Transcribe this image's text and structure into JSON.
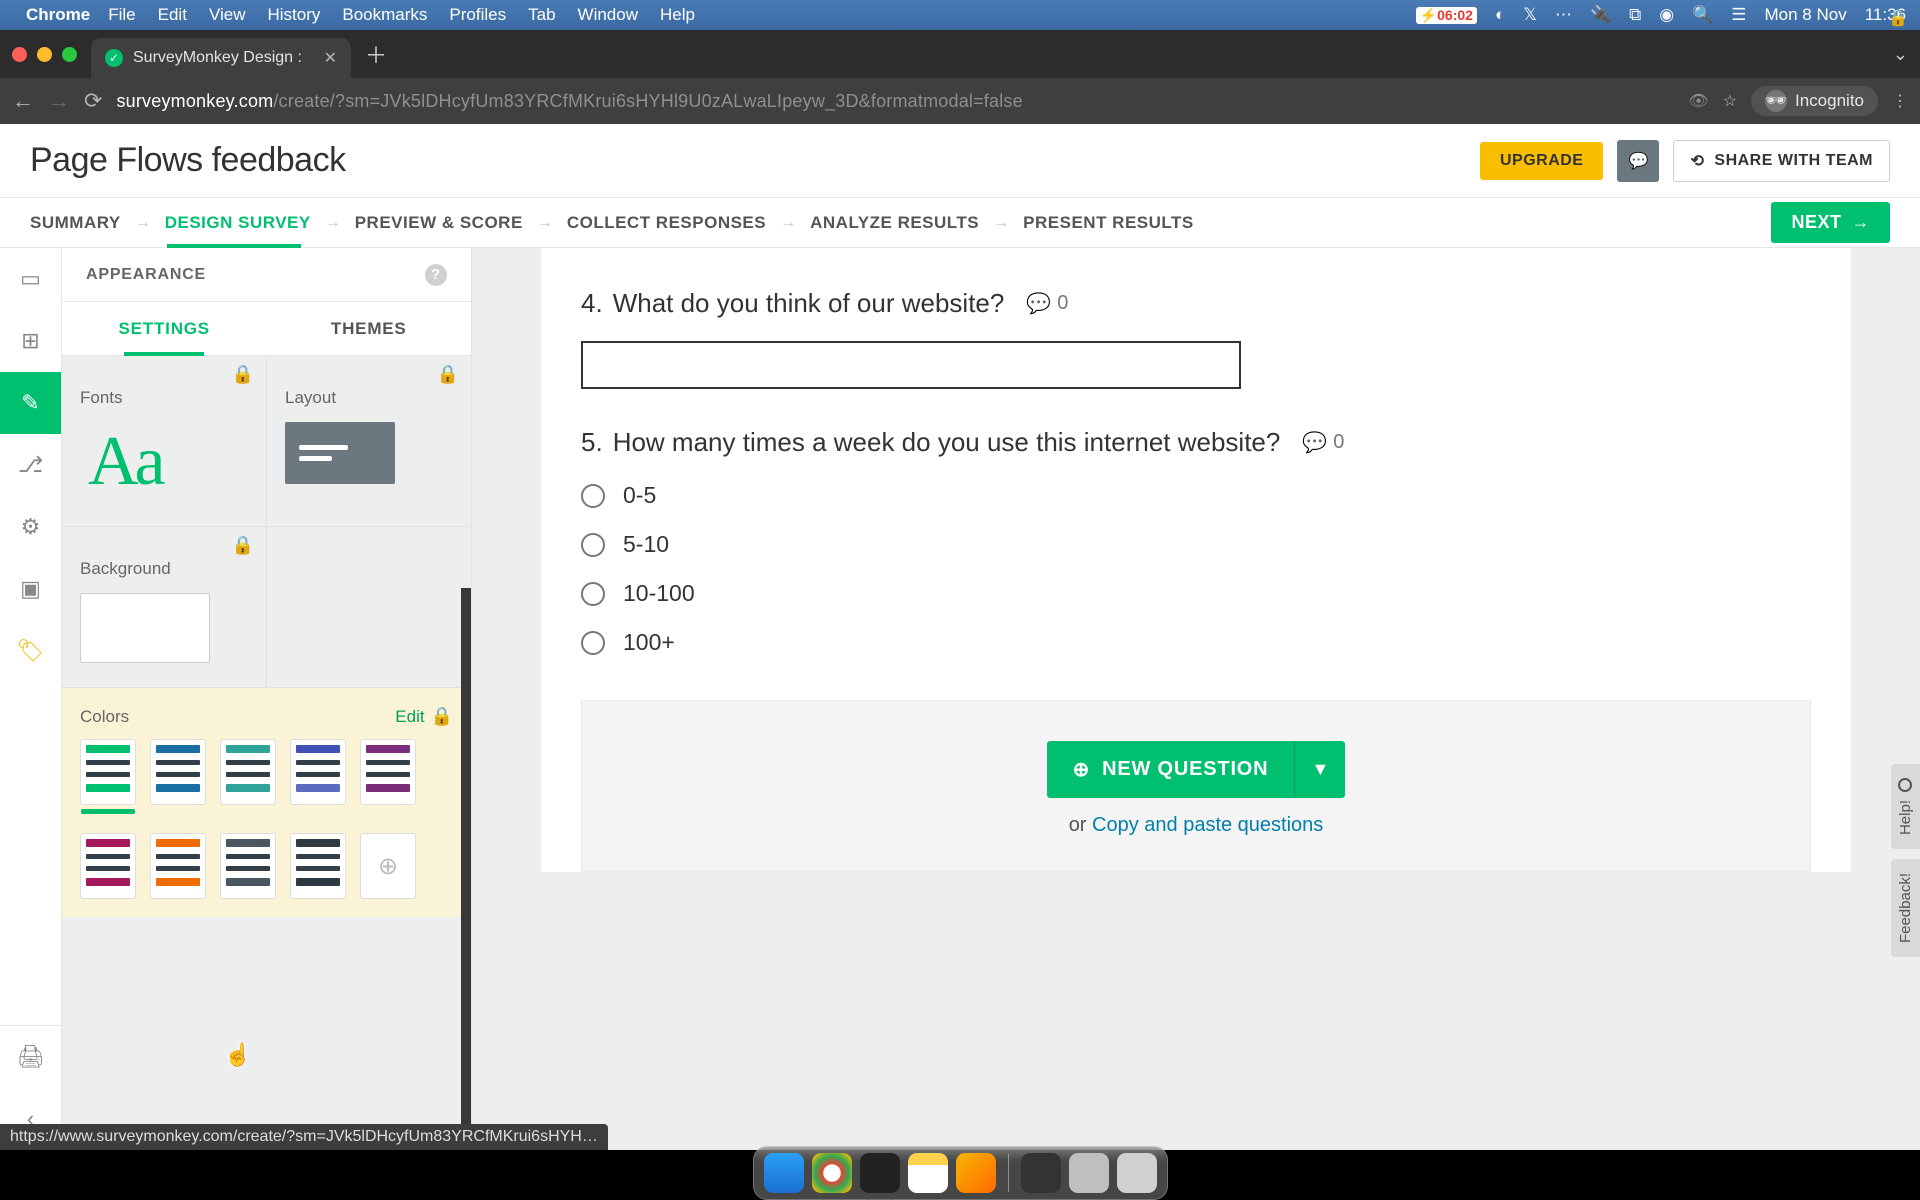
{
  "mac": {
    "app": "Chrome",
    "menus": [
      "File",
      "Edit",
      "View",
      "History",
      "Bookmarks",
      "Profiles",
      "Tab",
      "Window",
      "Help"
    ],
    "battery": "06:02",
    "date": "Mon 8 Nov",
    "time": "11:36"
  },
  "browser": {
    "tab_title": "SurveyMonkey Design :",
    "url_domain": "surveymonkey.com",
    "url_path": "/create/?sm=JVk5lDHcyfUm83YRCfMKrui6sHYHl9U0zALwaLIpeyw_3D&formatmodal=false",
    "incognito": "Incognito",
    "status_hover": "https://www.surveymonkey.com/create/?sm=JVk5lDHcyfUm83YRCfMKrui6sHYH…"
  },
  "header": {
    "title": "Page Flows feedback",
    "upgrade": "UPGRADE",
    "share": "SHARE WITH TEAM"
  },
  "steps": {
    "items": [
      "SUMMARY",
      "DESIGN SURVEY",
      "PREVIEW & SCORE",
      "COLLECT RESPONSES",
      "ANALYZE RESULTS",
      "PRESENT RESULTS"
    ],
    "next": "NEXT"
  },
  "panel": {
    "title": "APPEARANCE",
    "tabs": {
      "settings": "SETTINGS",
      "themes": "THEMES"
    },
    "fonts_label": "Fonts",
    "fonts_preview": "Aa",
    "layout_label": "Layout",
    "background_label": "Background",
    "colors_label": "Colors",
    "edit": "Edit"
  },
  "palettes": {
    "row1": [
      {
        "accent": "#00bf6f",
        "b": "#333f48",
        "c": "#00bf6f",
        "selected": true
      },
      {
        "accent": "#1a6fa3",
        "b": "#333f48",
        "c": "#1a6fa3"
      },
      {
        "accent": "#2fa39a",
        "b": "#333f48",
        "c": "#2fa39a"
      },
      {
        "accent": "#3f51b5",
        "b": "#333f48",
        "c": "#5c6bc0"
      },
      {
        "accent": "#7b2d7a",
        "b": "#333f48",
        "c": "#7b2d7a"
      }
    ],
    "row2": [
      {
        "accent": "#a3195b",
        "b": "#333f48",
        "c": "#a3195b"
      },
      {
        "accent": "#ef6c00",
        "b": "#333f48",
        "c": "#ef6c00"
      },
      {
        "accent": "#4a5761",
        "b": "#333f48",
        "c": "#4a5761"
      },
      {
        "accent": "#2d3a44",
        "b": "#333f48",
        "c": "#2d3a44"
      }
    ]
  },
  "survey": {
    "q4": {
      "num": "4.",
      "text": "What do you think of our website?",
      "count": "0"
    },
    "q5": {
      "num": "5.",
      "text": "How many times a week do you use this internet website?",
      "count": "0",
      "options": [
        "0-5",
        "5-10",
        "10-100",
        "100+"
      ]
    },
    "new_question": "NEW QUESTION",
    "or": "or ",
    "copy_paste": "Copy and paste questions"
  },
  "side": {
    "help": "Help!",
    "feedback": "Feedback!"
  },
  "dock": {
    "apps": [
      {
        "name": "finder",
        "bg": "linear-gradient(180deg,#2aa0f5,#1b6fd0)"
      },
      {
        "name": "chrome",
        "bg": "radial-gradient(circle,#fff 30%,#ea4335 32%,#34a853 60%,#fbbc05 90%)"
      },
      {
        "name": "terminal",
        "bg": "#222"
      },
      {
        "name": "notes",
        "bg": "linear-gradient(180deg,#ffd14d 30%,#fff 30%)"
      },
      {
        "name": "bolt",
        "bg": "linear-gradient(135deg,#f7b500,#ff6a00)"
      }
    ],
    "tray": [
      {
        "name": "screenshot",
        "bg": "#333"
      },
      {
        "name": "dash",
        "bg": "#bfbfbf"
      },
      {
        "name": "trash",
        "bg": "#d0d0d0"
      }
    ]
  }
}
